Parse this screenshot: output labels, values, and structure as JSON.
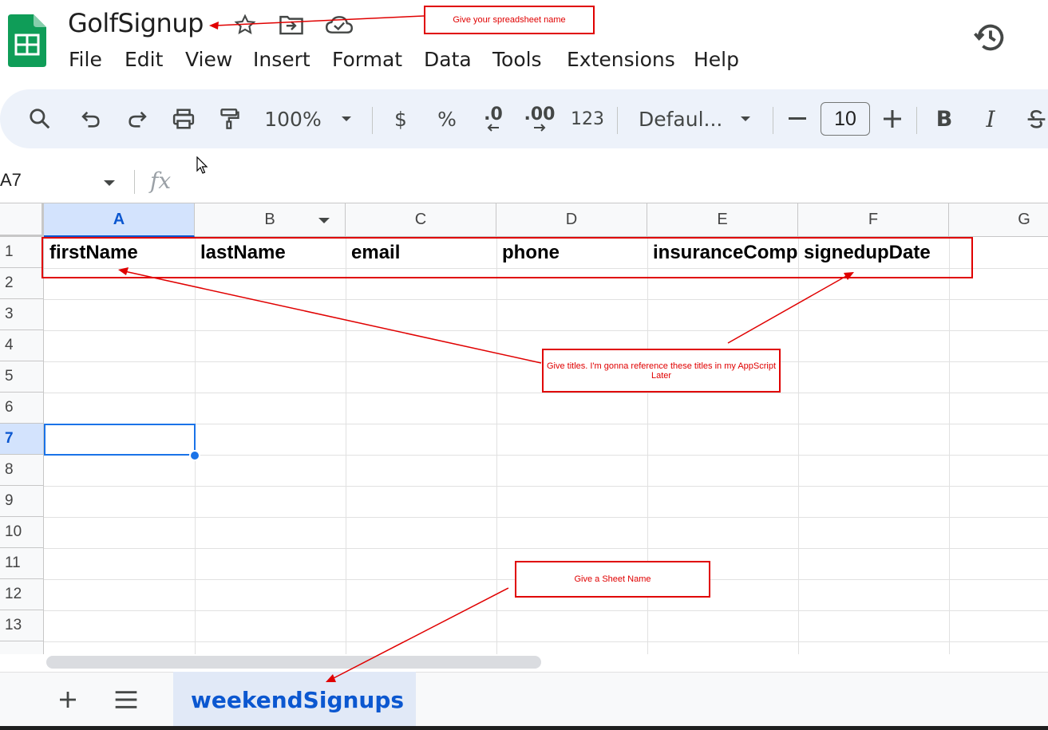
{
  "app": {
    "title": "GolfSignup"
  },
  "menu": [
    "File",
    "Edit",
    "View",
    "Insert",
    "Format",
    "Data",
    "Tools",
    "Extensions",
    "Help"
  ],
  "toolbar": {
    "zoom": "100%",
    "currency": "$",
    "percent": "%",
    "decrease_decimal": ".0",
    "increase_decimal": ".00",
    "number_format": "123",
    "font": "Defaul...",
    "font_size": "10",
    "bold": "B",
    "italic": "I"
  },
  "formula_bar": {
    "cell_ref": "A7",
    "fx": "fx"
  },
  "grid": {
    "columns": [
      "A",
      "B",
      "C",
      "D",
      "E",
      "F",
      "G"
    ],
    "rows": [
      "1",
      "2",
      "3",
      "4",
      "5",
      "6",
      "7",
      "8",
      "9",
      "10",
      "11",
      "12",
      "13"
    ],
    "selected_cell": "A7",
    "row1": [
      "firstName",
      "lastName",
      "email",
      "phone",
      "insuranceComp",
      "signedupDate"
    ]
  },
  "sheets": {
    "active": "weekendSignups"
  },
  "annotations": {
    "spreadsheet_name": "Give your spreadsheet name",
    "titles": "Give titles. I'm gonna reference these titles in my AppScript Later",
    "sheet_name": "Give a Sheet Name"
  },
  "colors": {
    "accent": "#0b57d0",
    "annotation": "#e00000",
    "logo_green": "#0f9d58"
  }
}
